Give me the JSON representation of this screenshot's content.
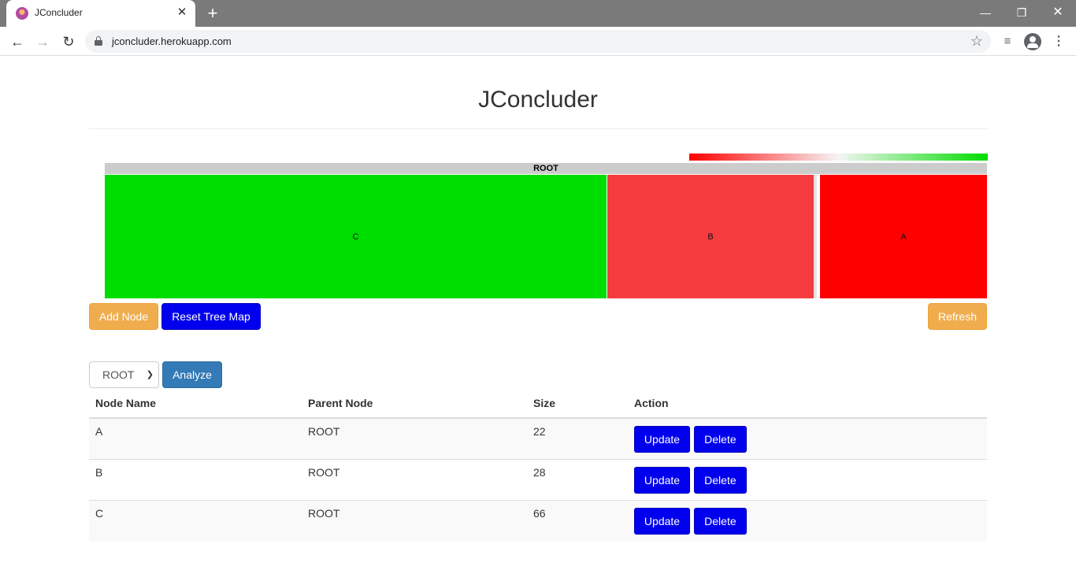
{
  "browser": {
    "tab_title": "JConcluder",
    "tab_close": "✕",
    "new_tab": "+",
    "url": "jconcluder.herokuapp.com",
    "window_controls": {
      "minimize": "—",
      "maximize": "❐",
      "close": "✕"
    },
    "icons": {
      "back": "←",
      "forward": "→",
      "reload": "↻",
      "star": "☆",
      "media": "≡",
      "menu": "⋮"
    }
  },
  "page": {
    "title": "JConcluder"
  },
  "treemap": {
    "root_label": "ROOT",
    "legend_colors": {
      "low": "#ff0000",
      "mid": "#f5f5f5",
      "high": "#00dd00"
    },
    "cells": [
      {
        "label": "C",
        "color": "#00dd00"
      },
      {
        "label": "B",
        "color": "#f63c3f"
      },
      {
        "label": "A",
        "color": "#ff0000"
      }
    ]
  },
  "controls": {
    "add_node": "Add Node",
    "reset_tree_map": "Reset Tree Map",
    "refresh": "Refresh",
    "select_value": "ROOT",
    "analyze": "Analyze"
  },
  "table": {
    "headers": {
      "name": "Node Name",
      "parent": "Parent Node",
      "size": "Size",
      "action": "Action"
    },
    "rows": [
      {
        "name": "A",
        "parent": "ROOT",
        "size": "22"
      },
      {
        "name": "B",
        "parent": "ROOT",
        "size": "28"
      },
      {
        "name": "C",
        "parent": "ROOT",
        "size": "66"
      }
    ],
    "update_label": "Update",
    "delete_label": "Delete"
  },
  "colors": {
    "warning": "#f0ad4e",
    "blue_button": "#0000ee",
    "primary": "#337ab7"
  }
}
